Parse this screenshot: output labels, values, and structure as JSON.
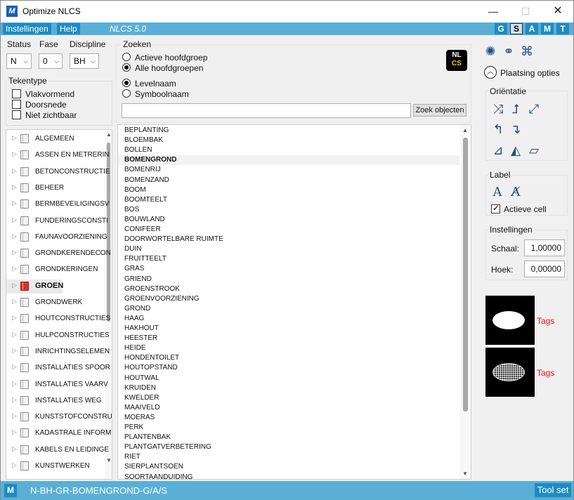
{
  "window": {
    "title": "Optimize NLCS",
    "icon_letter": "M",
    "minimize_icon": "minimize-icon",
    "maximize_icon": "maximize-icon",
    "close_icon": "close-icon"
  },
  "menubar": {
    "settings_label": "Instellingen",
    "help_label": "Help",
    "version": "NLCS 5.0",
    "modes": [
      "G",
      "S",
      "A",
      "M",
      "T"
    ],
    "active_mode": "S"
  },
  "filters": {
    "status_label": "Status",
    "fase_label": "Fase",
    "discipline_label": "Discipline",
    "status_value": "N",
    "fase_value": "0",
    "discipline_value": "BH"
  },
  "tekentype": {
    "title": "Tekentype",
    "options": [
      "Vlakvormend",
      "Doorsnede",
      "Niet zichtbaar"
    ]
  },
  "tree": {
    "items": [
      "ALGEMEEN",
      "ASSEN EN METRERIN",
      "BETONCONSTRUCTIE",
      "BEHEER",
      "BERMBEVEILIGINGSV",
      "FUNDERINGSCONSTI",
      "FAUNAVOORZIENING",
      "GRONDKERENDECON",
      "GRONDKERINGEN",
      "GROEN",
      "GRONDWERK",
      "HOUTCONSTRUCTIES",
      "HULPCONSTRUCTIES",
      "INRICHTINGSELEMEN",
      "INSTALLATIES SPOOR",
      "INSTALLATIES VAARV",
      "INSTALLATIES WEG",
      "KUNSTSTOFCONSTRU",
      "KADASTRALE INFORM",
      "KABELS EN LEIDINGE",
      "KUNSTWERKEN"
    ],
    "selected": "GROEN"
  },
  "search": {
    "title": "Zoeken",
    "scope_options": [
      "Actieve hoofdgroep",
      "Alle hoofdgroepen"
    ],
    "scope_selected": "Alle hoofdgroepen",
    "name_options": [
      "Levelnaam",
      "Symboolnaam"
    ],
    "name_selected": "Levelnaam",
    "query": "",
    "button_label": "Zoek objecten",
    "logo_top": "NL",
    "logo_bottom": "CS"
  },
  "levels": {
    "items": [
      "BEPLANTING",
      "BLOEMBAK",
      "BOLLEN",
      "BOMENGROND",
      "BOMENRIJ",
      "BOMENZAND",
      "BOOM",
      "BOOMTEELT",
      "BOS",
      "BOUWLAND",
      "CONIFEER",
      "DOORWORTELBARE RUIMTE",
      "DUIN",
      "FRUITTEELT",
      "GRAS",
      "GRIEND",
      "GROENSTROOK",
      "GROENVOORZIENING",
      "GROND",
      "HAAG",
      "HAKHOUT",
      "HEESTER",
      "HEIDE",
      "HONDENTOILET",
      "HOUTOPSTAND",
      "HOUTWAL",
      "KRUIDEN",
      "KWELDER",
      "MAAIVELD",
      "MOERAS",
      "PERK",
      "PLANTENBAK",
      "PLANTGATVERBETERING",
      "RIET",
      "SIERPLANTSOEN",
      "SOORTAANDUIDING"
    ],
    "selected": "BOMENGROND"
  },
  "right": {
    "plaatsing_label": "Plaatsing opties",
    "orientatie_title": "Oriëntatie",
    "label_title": "Label",
    "actieve_cell_label": "Actieve cell",
    "actieve_cell_checked": true,
    "instellingen_title": "Instellingen",
    "schaal_label": "Schaal:",
    "schaal_value": "1,00000",
    "hoek_label": "Hoek:",
    "hoek_value": "0,00000",
    "tags_1": "Tags",
    "tags_2": "Tags"
  },
  "statusbar": {
    "mode_letter": "M",
    "level_path": "N-BH-GR-BOMENGROND-G/A/S",
    "toolset_label": "Tool set"
  },
  "colors": {
    "accent": "#1e8bc3",
    "bar": "#5aafd6",
    "tags_red": "#e11111"
  }
}
